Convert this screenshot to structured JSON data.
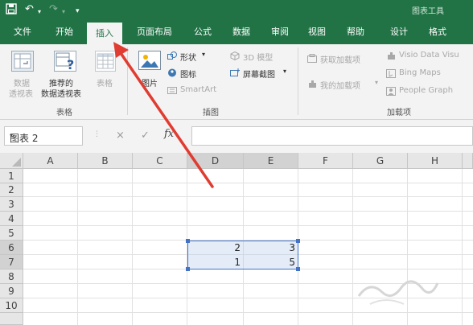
{
  "app": {
    "context_tab_title": "图表工具",
    "accent_color": "#217346",
    "selection_color": "#4472c4",
    "arrow_color": "#e03c31"
  },
  "quick_access": {
    "save_icon": "save-icon",
    "undo_icon": "undo-icon",
    "redo_icon": "redo-icon"
  },
  "tabs": [
    {
      "label": "文件",
      "active": false
    },
    {
      "label": "开始",
      "active": false
    },
    {
      "label": "插入",
      "active": true
    },
    {
      "label": "页面布局",
      "active": false
    },
    {
      "label": "公式",
      "active": false
    },
    {
      "label": "数据",
      "active": false
    },
    {
      "label": "审阅",
      "active": false
    },
    {
      "label": "视图",
      "active": false
    },
    {
      "label": "帮助",
      "active": false
    },
    {
      "label": "设计",
      "active": false
    },
    {
      "label": "格式",
      "active": false
    }
  ],
  "ribbon": {
    "tables": {
      "pivot_line1": "数据",
      "pivot_line2": "透视表",
      "recommended_line1": "推荐的",
      "recommended_line2": "数据透视表",
      "table": "表格",
      "group": "表格"
    },
    "illustrations": {
      "picture": "图片",
      "shapes": "形状",
      "icons": "图标",
      "smartart": "SmartArt",
      "model3d": "3D 模型",
      "screenshot": "屏幕截图",
      "group": "插图"
    },
    "addins": {
      "get_addins": "获取加载项",
      "my_addins": "我的加载项",
      "visio": "Visio Data Visu",
      "bing": "Bing Maps",
      "people": "People Graph",
      "group": "加载项"
    }
  },
  "formula_bar": {
    "name_box": "图表 2",
    "cancel_icon": "×",
    "enter_icon": "✓",
    "fx": "fx",
    "value": ""
  },
  "sheet": {
    "columns": [
      "A",
      "B",
      "C",
      "D",
      "E",
      "F",
      "G",
      "H"
    ],
    "rows": [
      "1",
      "2",
      "3",
      "4",
      "5",
      "6",
      "7",
      "8",
      "9",
      "10"
    ],
    "cells": {
      "D6": "2",
      "E6": "3",
      "D7": "1",
      "E7": "5"
    },
    "selection": "D6:E7"
  }
}
